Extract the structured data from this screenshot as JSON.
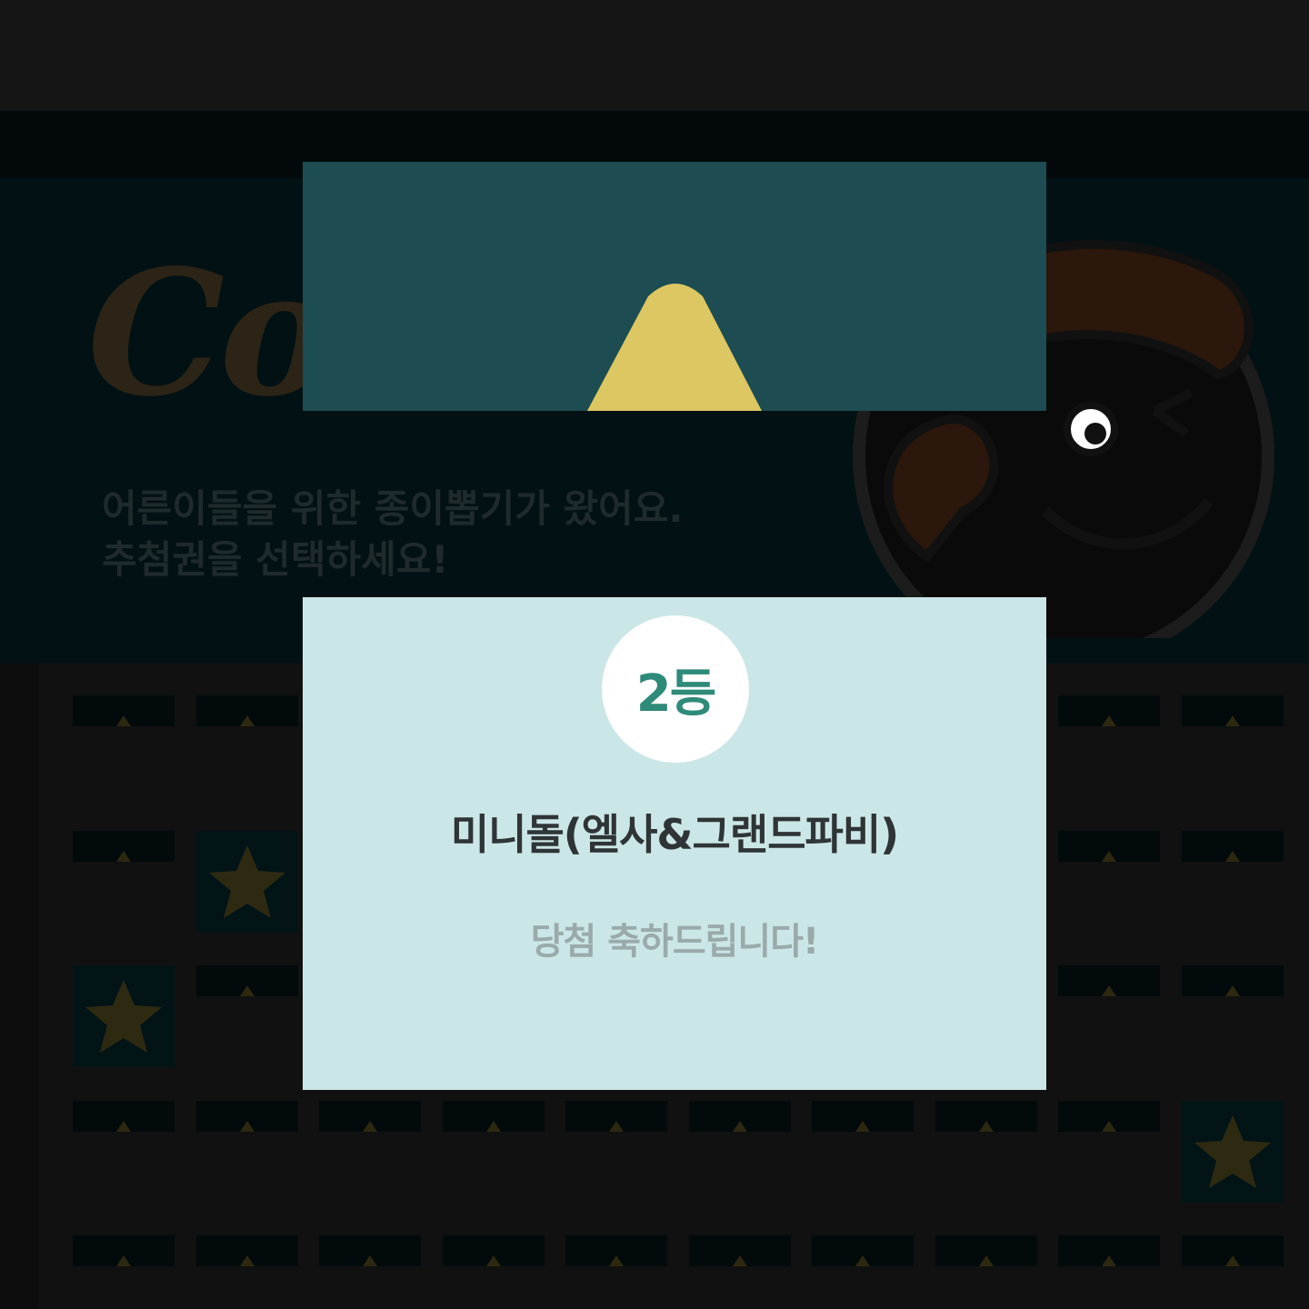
{
  "background_page": {
    "hero": {
      "logo_text": "Co",
      "description": "어른이들을 위한 종이뽑기가 왔어요.\n추첨권을 선택하세요!"
    },
    "ticket_grid": {
      "rows": 5,
      "columns": 10,
      "opened_tickets": [
        [
          1,
          1
        ],
        [
          2,
          0
        ],
        [
          3,
          9
        ]
      ]
    }
  },
  "modal": {
    "rank": "2등",
    "prize_name": "미니돌(엘사&그랜드파비)",
    "message": "당첨 축하드립니다!"
  },
  "colors": {
    "modal_header": "#1d4c52",
    "peak": "#dcc762",
    "modal_body": "#cbe6e6",
    "rank_text": "#2e8a79"
  }
}
